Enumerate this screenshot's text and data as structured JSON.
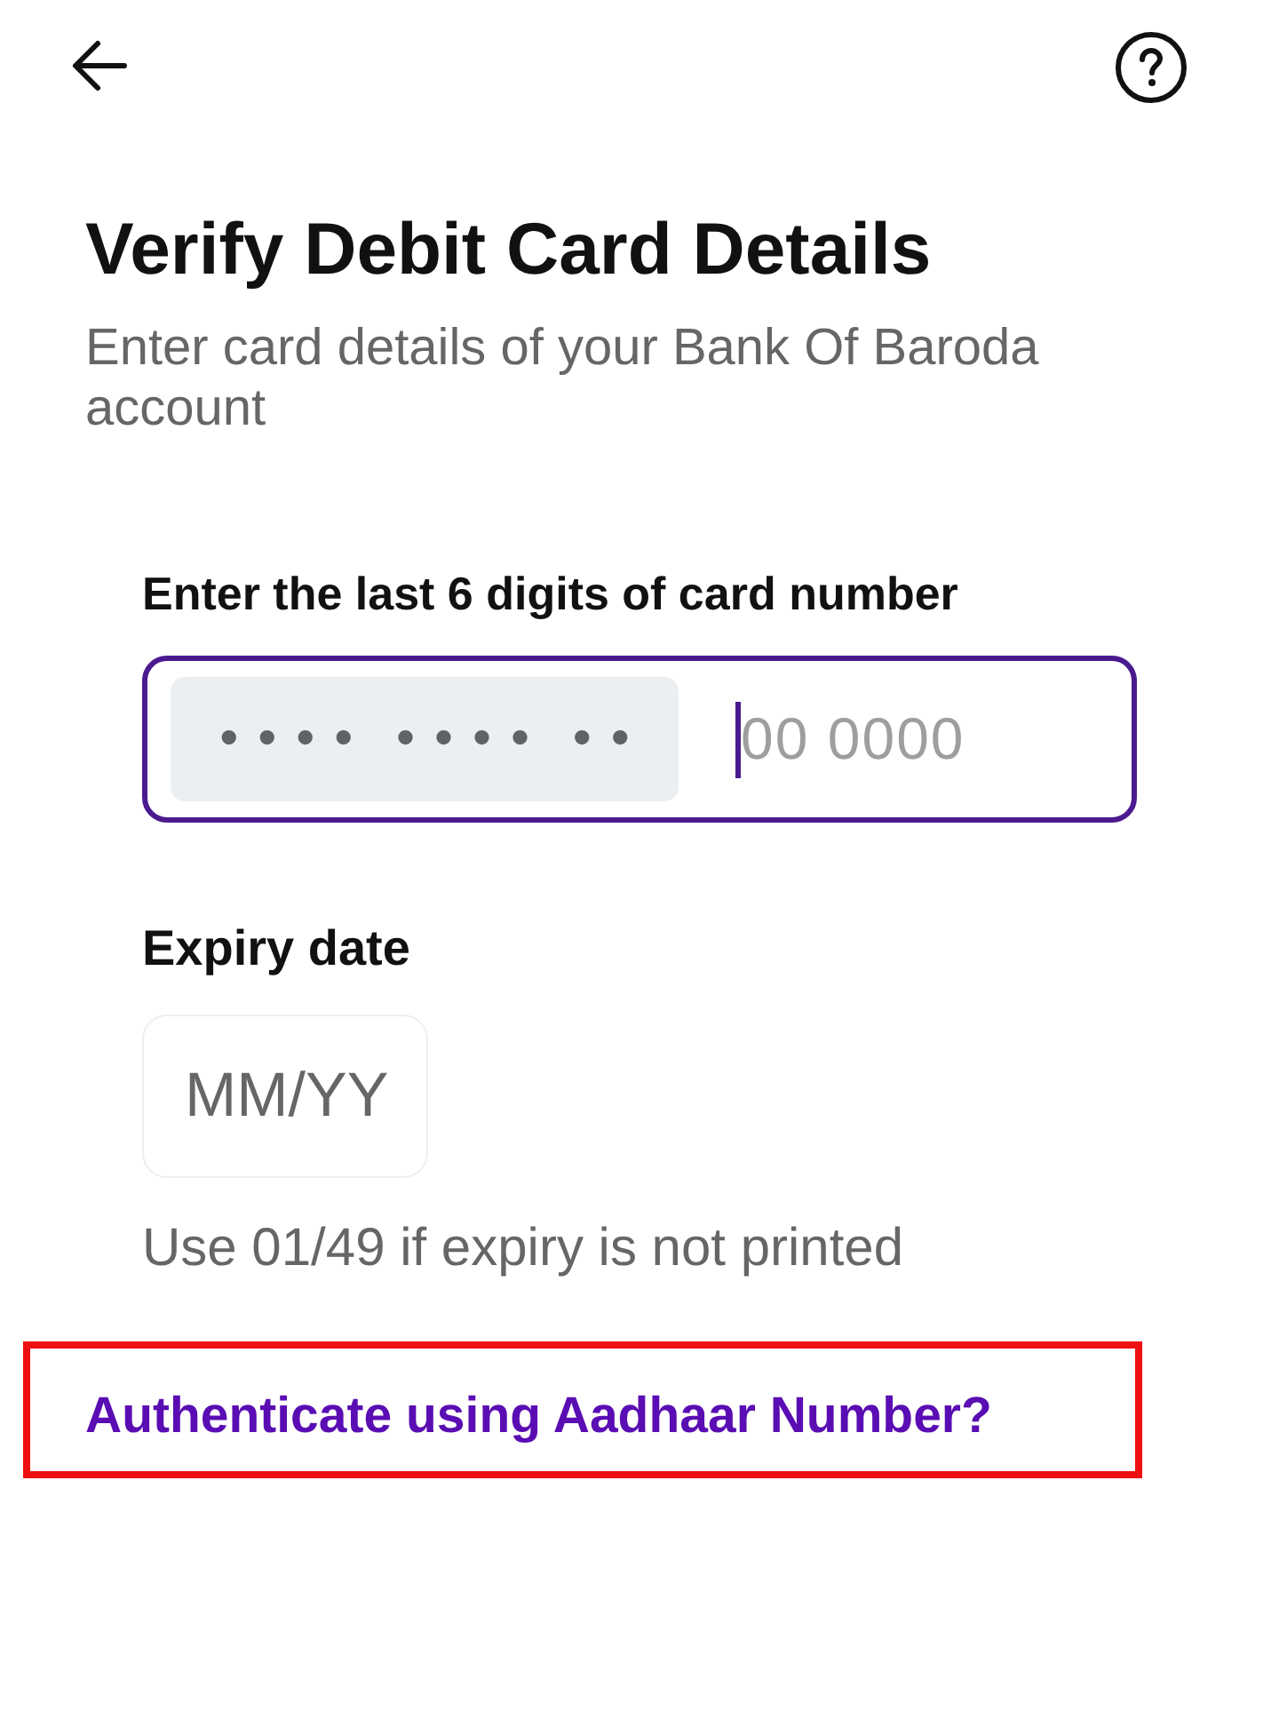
{
  "heading": {
    "title": "Verify Debit Card Details",
    "subtitle": "Enter card details of your Bank Of Baroda account"
  },
  "card_number": {
    "label": "Enter the last 6 digits of card number",
    "masked_prefix": "•••• •••• ••",
    "placeholder": "00 0000",
    "focused": true
  },
  "expiry": {
    "label": "Expiry date",
    "placeholder": "MM/YY",
    "focused": false,
    "hint": "Use 01/49 if expiry is not printed"
  },
  "alternate_link": {
    "label": "Authenticate using Aadhaar Number?",
    "highlighted": true
  }
}
